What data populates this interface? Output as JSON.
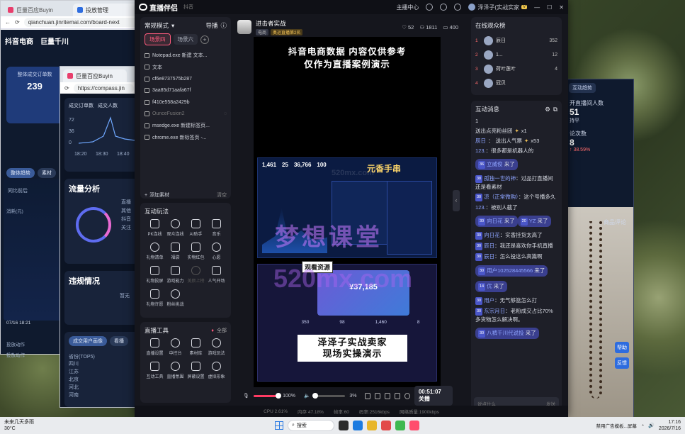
{
  "background_left": {
    "tabs": [
      {
        "label": "巨量百应Buyin"
      },
      {
        "label": "投放管理"
      }
    ],
    "url": "qianchuan.jinritemai.com/board-next",
    "brand_douyin": "抖音电商",
    "brand_qc": "巨量千川",
    "stat_label": "整体成交订单数",
    "stat_value": "239",
    "pills": [
      "整体趋势",
      "素材"
    ],
    "legend_item": "同比前后",
    "y_label": "消耗(元)",
    "chart_time": "07/16 18:21",
    "row_labels": [
      "投放动作",
      "投放动作"
    ]
  },
  "background_front": {
    "tab": "巨量百应Buyin",
    "url": "https://compass.jin",
    "chips": [
      "成交订单数",
      "成交人数"
    ],
    "ticks": [
      "72",
      "36",
      "0"
    ],
    "times": [
      "18:20",
      "18:30",
      "18:40"
    ],
    "flow_title": "流量分析",
    "flow_items": [
      "直播",
      "其他",
      "抖音",
      "关注"
    ],
    "rule_title": "违规情况",
    "rule_text": "暂无",
    "persona_tabs": [
      "成交用户画像",
      "看播"
    ],
    "region_title": "省份(TOP5)",
    "regions": [
      "四川",
      "江苏",
      "北京",
      "河北",
      "河南"
    ]
  },
  "background_right": {
    "tabs": [
      "互动趋势"
    ],
    "label1": "开直播间人数",
    "value1": "51",
    "label1b": "持平",
    "label2": "论次数",
    "value2": "8",
    "change": "↑ 38.59%",
    "comment_tab": "商品评论",
    "float_buttons": [
      "帮助",
      "反馈"
    ]
  },
  "app": {
    "brand": "直播伴侣",
    "brand_sub": "抖音",
    "top_right": [
      "主播中心",
      "进主页",
      "评论",
      "设置"
    ],
    "user": "泽泽子(实战实家",
    "user_badge": "V",
    "left": {
      "mode": "常规模式",
      "mode_right": "导播",
      "scenes": [
        "场景四",
        "场景六"
      ],
      "sources": [
        {
          "name": "Notepad.exe 新建 文本...",
          "dim": false
        },
        {
          "name": "文本",
          "dim": false
        },
        {
          "name": "cf6e8737575b287",
          "dim": false
        },
        {
          "name": "3aa85d71aafa67f",
          "dim": false
        },
        {
          "name": "f410e558a2429b",
          "dim": false
        },
        {
          "name": "OunceFusion2",
          "dim": true
        },
        {
          "name": "msedge.exe 新建标签页...",
          "dim": false
        },
        {
          "name": "chrome.exe 新标签页 -...",
          "dim": false
        }
      ],
      "add_source": "添加素材",
      "clear": "清空",
      "tools_title": "互动玩法",
      "tools": [
        {
          "label": "PK连线",
          "off": false
        },
        {
          "label": "观众连线",
          "off": false
        },
        {
          "label": "AI助手",
          "off": false
        },
        {
          "label": "音乐",
          "off": false
        },
        {
          "label": "礼物清单",
          "off": false
        },
        {
          "label": "福袋",
          "off": false
        },
        {
          "label": "实物红包",
          "off": false
        },
        {
          "label": "心愿",
          "off": false
        },
        {
          "label": "礼物投屏",
          "off": false
        },
        {
          "label": "游戏能力",
          "off": false
        },
        {
          "label": "美颜上榜",
          "off": true
        },
        {
          "label": "人气开场",
          "off": false
        },
        {
          "label": "礼物许愿",
          "off": false
        },
        {
          "label": "粉丝挑战",
          "off": false
        }
      ],
      "basic_title": "直播工具",
      "basic_more": "全部",
      "basic_tools": [
        {
          "label": "直播设置"
        },
        {
          "label": "中控台"
        },
        {
          "label": "素材库"
        },
        {
          "label": "游戏玩法"
        },
        {
          "label": "互动工具"
        },
        {
          "label": "直播氛围"
        },
        {
          "label": "屏蔽设置"
        },
        {
          "label": "虚拟形象"
        }
      ]
    },
    "center": {
      "streamer": "进击者实战",
      "tags": [
        "电商",
        "奥运直播第2名"
      ],
      "stats": {
        "likes": "52",
        "viewers": "1811",
        "online": "400"
      },
      "preview_title_1": "抖音电商数据 内容仅供参考",
      "preview_title_2": "仅作为直播案例演示",
      "dash_numbers": [
        "1,461",
        "25",
        "36,766",
        "100"
      ],
      "dash_banner": "元香手串",
      "dash_amount": "¥37,185",
      "dash_small": [
        "350",
        "98",
        "1,460",
        "8"
      ],
      "overlay_tag": "观看资源",
      "caption_1": "泽泽子实战卖家",
      "caption_2": "现场实操演示",
      "watermark_big": "梦想课堂",
      "watermark_url": "520mx.com",
      "watermark_faint": "520mx.com",
      "mic_volume": "100%",
      "speaker_volume": "3%",
      "timer": "00:51:07",
      "end_label": "关播",
      "mic_fraction": 1.0,
      "speaker_fraction": 0.03
    },
    "right": {
      "rank_title": "在线观众榜",
      "rank": [
        {
          "name": "辰日",
          "score": "352"
        },
        {
          "name": "1...",
          "score": "12"
        },
        {
          "name": "荷叶莲叶",
          "score": "4"
        },
        {
          "name": "冠贝",
          "score": ""
        }
      ],
      "chat_title": "互动消息",
      "chat_input": "说点什么",
      "chat_send": "发送",
      "messages": [
        {
          "type": "text",
          "text": "1"
        },
        {
          "type": "gift",
          "text": "送出点亮粉丝团",
          "count": "x1"
        },
        {
          "type": "gift",
          "name": "辰日",
          "text": "送出人气票",
          "count": "x53"
        },
        {
          "type": "text",
          "name": "123.",
          "text": "很多都是机器人的"
        },
        {
          "type": "join",
          "lv": "36",
          "name": "立威俊",
          "text": "来了"
        },
        {
          "type": "text",
          "lv": "38",
          "name": "孤独一世的神",
          "text": "过品打直播间还是看素材"
        },
        {
          "type": "text",
          "lv": "30",
          "name": "凉（正常微购）",
          "text": "这个号播多久"
        },
        {
          "type": "text",
          "name": "123.",
          "text": "被别人截了"
        },
        {
          "type": "join",
          "lv": "30",
          "name": "向日花",
          "text": "来了"
        },
        {
          "type": "join",
          "lv": "20",
          "name": "YZ",
          "text": "来了"
        },
        {
          "type": "text",
          "lv": "30",
          "name": "向日花",
          "text": "实香挂货太高了"
        },
        {
          "type": "text",
          "lv": "30",
          "name": "辰日",
          "text": "我还是喜欢你手机直播"
        },
        {
          "type": "text",
          "lv": "30",
          "name": "辰日",
          "text": "怎么投这么高篇啊"
        },
        {
          "type": "join",
          "lv": "30",
          "name": "用户102528445566",
          "text": "来了"
        },
        {
          "type": "join",
          "lv": "14",
          "name": "优",
          "text": "来了"
        },
        {
          "type": "text",
          "lv": "30",
          "name": "用户",
          "text": "无气够篮怎么打"
        },
        {
          "type": "text",
          "lv": "30",
          "name": "东宗月日",
          "text": "老粉成交占比70%多货物怎么解决啊。"
        },
        {
          "type": "join",
          "lv": "30",
          "name": "八裤千川代说投",
          "text": "来了"
        }
      ]
    },
    "status": {
      "cpu": "CPU 2.61%",
      "mem": "内存 47.18%",
      "fps": "帧率:60",
      "bitrate": "码率:2516kbps",
      "quality": "网络质量:1900kbps"
    }
  },
  "taskbar": {
    "weather_1": "未来几天多雨",
    "weather_2": "30°C",
    "search": "搜索",
    "time": "17:16",
    "date": "2026/7/16",
    "notice": "禁用广告模板...屏幕"
  }
}
